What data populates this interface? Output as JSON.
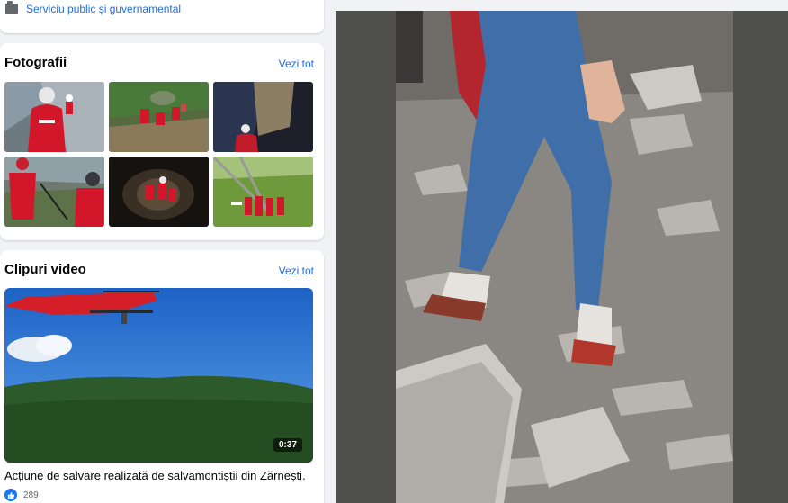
{
  "category": {
    "label": "Serviciu public și guvernamental",
    "icon": "briefcase-icon"
  },
  "photos": {
    "title": "Fotografii",
    "see_all": "Vezi tot",
    "count": 6
  },
  "videos": {
    "title": "Clipuri video",
    "see_all": "Vezi tot",
    "items": [
      {
        "duration": "0:37",
        "title": " Acțiune de salvare realizată de salvamontiștii din Zărnești.",
        "likes": "289"
      }
    ]
  },
  "colors": {
    "link": "#216fdb",
    "like": "#1877f2",
    "rescue_red": "#d3172a",
    "viewer_bg": "#4f4f4d"
  }
}
